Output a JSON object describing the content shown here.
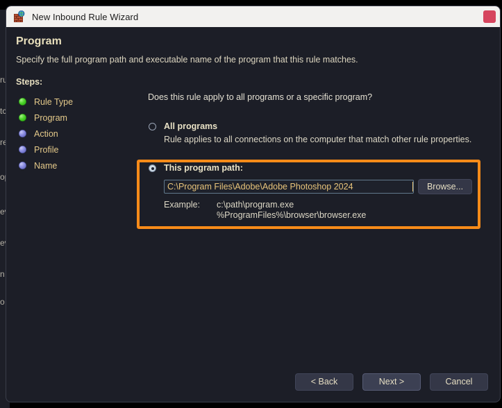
{
  "window": {
    "title": "New Inbound Rule Wizard",
    "icon": "firewall-brick-wall-globe-icon",
    "close_label": "",
    "close_color": "#d6455e"
  },
  "header": {
    "title": "Program",
    "subtitle": "Specify the full program path and executable name of the program that this rule matches."
  },
  "steps": {
    "label": "Steps:",
    "items": [
      {
        "label": "Rule Type",
        "state": "done"
      },
      {
        "label": "Program",
        "state": "done"
      },
      {
        "label": "Action",
        "state": "pending"
      },
      {
        "label": "Profile",
        "state": "pending"
      },
      {
        "label": "Name",
        "state": "pending"
      }
    ]
  },
  "main": {
    "question": "Does this rule apply to all programs or a specific program?",
    "options": [
      {
        "title": "All programs",
        "description": "Rule applies to all connections on the computer that match other rule properties.",
        "selected": false
      },
      {
        "title": "This program path:",
        "selected": true
      }
    ],
    "path_input": {
      "value": "C:\\Program Files\\Adobe\\Adobe Photoshop 2024",
      "placeholder": ""
    },
    "browse_label": "Browse...",
    "example_label": "Example:",
    "example_values": [
      "c:\\path\\program.exe",
      "%ProgramFiles%\\browser\\browser.exe"
    ]
  },
  "highlight": {
    "color": "#f78b19"
  },
  "footer": {
    "back_label": "< Back",
    "next_label": "Next >",
    "cancel_label": "Cancel"
  },
  "background_window": {
    "fragments": [
      "ru",
      "tc",
      "re",
      "op",
      "ev",
      "ev",
      "n",
      "o"
    ]
  }
}
